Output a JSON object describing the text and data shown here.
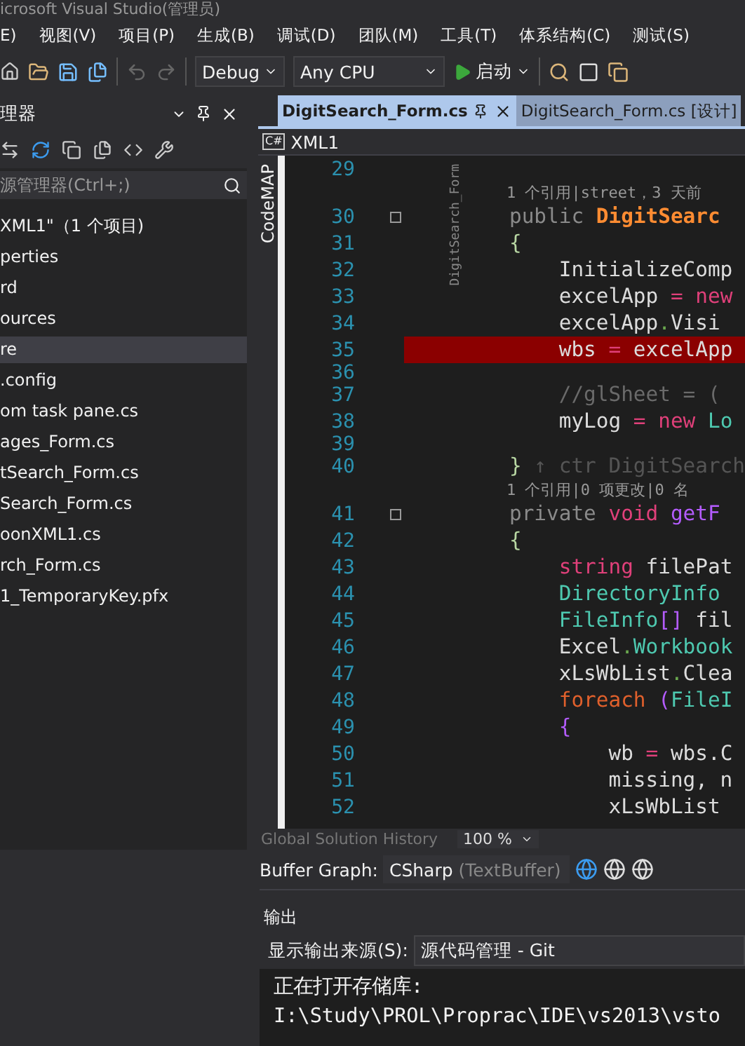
{
  "window": {
    "title": "icrosoft Visual Studio(管理员)"
  },
  "menu": [
    "E)",
    "视图(V)",
    "项目(P)",
    "生成(B)",
    "调试(D)",
    "团队(M)",
    "工具(T)",
    "体系结构(C)",
    "测试(S)"
  ],
  "toolbar": {
    "configuration": "Debug",
    "platform": "Any CPU",
    "start": "启动"
  },
  "solution_explorer": {
    "title": "理器",
    "search": {
      "placeholder": "源管理器(Ctrl+;)"
    },
    "items": [
      {
        "label": "XML1\"（1 个项目)",
        "selected": false
      },
      {
        "label": "perties",
        "selected": false
      },
      {
        "label": "rd",
        "selected": false
      },
      {
        "label": "ources",
        "selected": false
      },
      {
        "label": "re",
        "selected": true
      },
      {
        "label": ".config",
        "selected": false
      },
      {
        "label": "om task pane.cs",
        "selected": false
      },
      {
        "label": "ages_Form.cs",
        "selected": false
      },
      {
        "label": "tSearch_Form.cs",
        "selected": false
      },
      {
        "label": "Search_Form.cs",
        "selected": false
      },
      {
        "label": "oonXML1.cs",
        "selected": false
      },
      {
        "label": "rch_Form.cs",
        "selected": false
      },
      {
        "label": "1_TemporaryKey.pfx",
        "selected": false
      }
    ]
  },
  "editor": {
    "tabs": [
      {
        "label": "DigitSearch_Form.cs",
        "selected": true
      },
      {
        "label": "DigitSearch_Form.cs [设计]",
        "selected": false
      }
    ],
    "nav_icon": "C#",
    "nav": "XML1",
    "side_label": "CodeMAP",
    "structure_label": "DigitSearch_Form",
    "lines": [
      {
        "kind": "code",
        "num": "29",
        "fold": false,
        "highlighted": false
      },
      {
        "kind": "lens",
        "text": "1 个引用|street，3 天前"
      },
      {
        "kind": "code",
        "num": "30",
        "fold": true,
        "highlighted": false,
        "tokens": [
          {
            "t": "public ",
            "kind": "dim"
          },
          {
            "t": "DigitSearc",
            "kind": "decl"
          }
        ]
      },
      {
        "kind": "code",
        "num": "31",
        "fold": false,
        "highlighted": false,
        "tokens": [
          {
            "t": "{",
            "kind": "brace"
          }
        ]
      },
      {
        "kind": "code",
        "num": "32",
        "fold": false,
        "highlighted": false,
        "tokens": [
          {
            "t": "    InitializeComp",
            "kind": "plain"
          }
        ]
      },
      {
        "kind": "code",
        "num": "33",
        "fold": false,
        "highlighted": false,
        "tokens": [
          {
            "t": "    excelApp ",
            "kind": "plain"
          },
          {
            "t": "= ",
            "kind": "punct"
          },
          {
            "t": "new",
            "kind": "kw"
          }
        ]
      },
      {
        "kind": "code",
        "num": "34",
        "fold": false,
        "highlighted": false,
        "tokens": [
          {
            "t": "    excelApp",
            "kind": "plain"
          },
          {
            "t": ".",
            "kind": "dot"
          },
          {
            "t": "Visi",
            "kind": "plain"
          }
        ]
      },
      {
        "kind": "code",
        "num": "35",
        "fold": false,
        "highlighted": true,
        "tokens": [
          {
            "t": "    wbs ",
            "kind": "plain"
          },
          {
            "t": "=",
            "kind": "punct"
          },
          {
            "t": " excelApp",
            "kind": "plain"
          }
        ]
      },
      {
        "kind": "blank",
        "num": "36",
        "fold": false,
        "highlighted": false
      },
      {
        "kind": "code",
        "num": "37",
        "fold": false,
        "highlighted": false,
        "tokens": [
          {
            "t": "    //glSheet = (",
            "kind": "comment"
          }
        ]
      },
      {
        "kind": "code",
        "num": "38",
        "fold": false,
        "highlighted": false,
        "tokens": [
          {
            "t": "    myLog ",
            "kind": "plain"
          },
          {
            "t": "= new",
            "kind": "kw"
          },
          {
            "t": " Lo",
            "kind": "type"
          }
        ]
      },
      {
        "kind": "blank",
        "num": "39",
        "fold": false,
        "highlighted": false
      },
      {
        "kind": "code",
        "num": "40",
        "fold": false,
        "highlighted": false,
        "tokens": [
          {
            "t": "}",
            "kind": "brace"
          },
          {
            "t": " ↑ ctr DigitSearch",
            "kind": "faint"
          }
        ]
      },
      {
        "kind": "lens",
        "text": "1 个引用|0 项更改|0 名"
      },
      {
        "kind": "code",
        "num": "41",
        "fold": true,
        "highlighted": false,
        "tokens": [
          {
            "t": "private ",
            "kind": "dim"
          },
          {
            "t": "void ",
            "kind": "kw"
          },
          {
            "t": "getF",
            "kind": "method"
          }
        ]
      },
      {
        "kind": "code",
        "num": "42",
        "fold": false,
        "highlighted": false,
        "tokens": [
          {
            "t": "{",
            "kind": "brace"
          }
        ]
      },
      {
        "kind": "code",
        "num": "43",
        "fold": false,
        "highlighted": false,
        "tokens": [
          {
            "t": "    string",
            "kind": "kw"
          },
          {
            "t": " filePat",
            "kind": "plain"
          }
        ]
      },
      {
        "kind": "code",
        "num": "44",
        "fold": false,
        "highlighted": false,
        "tokens": [
          {
            "t": "    DirectoryInfo",
            "kind": "type"
          }
        ]
      },
      {
        "kind": "code",
        "num": "45",
        "fold": false,
        "highlighted": false,
        "tokens": [
          {
            "t": "    FileInfo",
            "kind": "type"
          },
          {
            "t": "[]",
            "kind": "method"
          },
          {
            "t": " fil",
            "kind": "plain"
          }
        ]
      },
      {
        "kind": "code",
        "num": "46",
        "fold": false,
        "highlighted": false,
        "tokens": [
          {
            "t": "    Excel",
            "kind": "plain"
          },
          {
            "t": ".",
            "kind": "dot"
          },
          {
            "t": "Workbook",
            "kind": "type"
          }
        ]
      },
      {
        "kind": "code",
        "num": "47",
        "fold": false,
        "highlighted": false,
        "tokens": [
          {
            "t": "    xLsWbList",
            "kind": "plain"
          },
          {
            "t": ".",
            "kind": "dot"
          },
          {
            "t": "Clea",
            "kind": "plain"
          }
        ]
      },
      {
        "kind": "code",
        "num": "48",
        "fold": false,
        "highlighted": false,
        "tokens": [
          {
            "t": "    foreach",
            "kind": "ctrl"
          },
          {
            "t": " (",
            "kind": "method"
          },
          {
            "t": "FileI",
            "kind": "type"
          }
        ]
      },
      {
        "kind": "code",
        "num": "49",
        "fold": false,
        "highlighted": false,
        "tokens": [
          {
            "t": "    {",
            "kind": "method"
          }
        ]
      },
      {
        "kind": "code",
        "num": "50",
        "fold": false,
        "highlighted": false,
        "tokens": [
          {
            "t": "        wb ",
            "kind": "plain"
          },
          {
            "t": "=",
            "kind": "punct"
          },
          {
            "t": " wbs.C",
            "kind": "plain"
          }
        ]
      },
      {
        "kind": "code",
        "num": "51",
        "fold": false,
        "highlighted": false,
        "tokens": [
          {
            "t": "        missing, n",
            "kind": "plain"
          }
        ]
      },
      {
        "kind": "code",
        "num": "52",
        "fold": false,
        "highlighted": false,
        "tokens": [
          {
            "t": "        xLsWbList",
            "kind": "plain"
          }
        ]
      }
    ],
    "history": "Global Solution History",
    "zoom": "100 %"
  },
  "buffer_graph": {
    "label": "Buffer Graph:",
    "value": "CSharp",
    "hint": "(TextBuffer)"
  },
  "output": {
    "title": "输出",
    "source_label": "显示输出来源(S):",
    "source": "源代码管理 - Git",
    "lines": [
      "正在打开存储库:",
      "I:\\Study\\PROL\\Proprac\\IDE\\vs2013\\vsto"
    ]
  }
}
